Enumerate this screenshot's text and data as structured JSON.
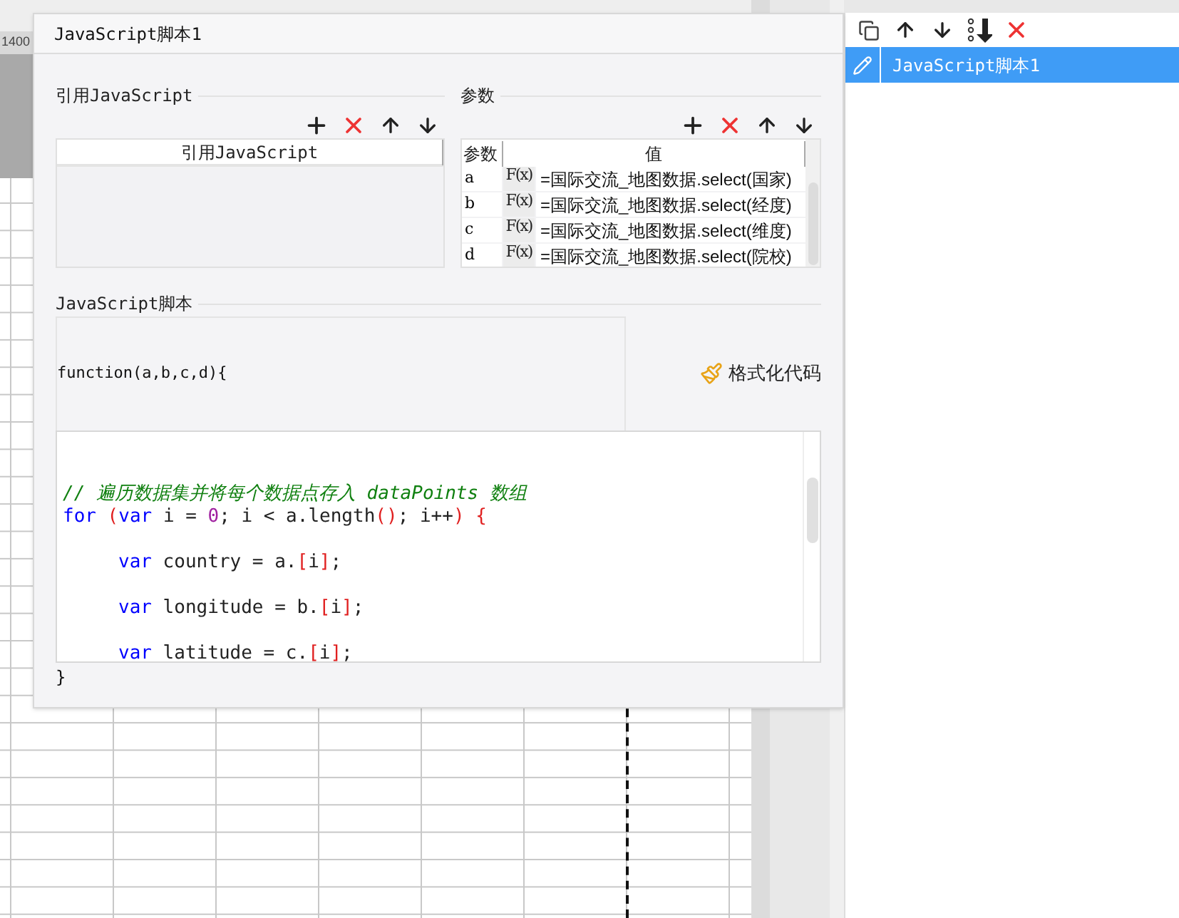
{
  "ruler": {
    "label": "1400"
  },
  "dialog": {
    "title": "JavaScript脚本1",
    "ref_section": {
      "title": "引用JavaScript",
      "column": "引用JavaScript"
    },
    "params_section": {
      "title": "参数",
      "columns": [
        "参数",
        "值"
      ],
      "rows": [
        {
          "name": "a",
          "formula_label": "F(x)",
          "value": "=国际交流_地图数据.select(国家)"
        },
        {
          "name": "b",
          "formula_label": "F(x)",
          "value": "=国际交流_地图数据.select(经度)"
        },
        {
          "name": "c",
          "formula_label": "F(x)",
          "value": "=国际交流_地图数据.select(维度)"
        },
        {
          "name": "d",
          "formula_label": "F(x)",
          "value": "=国际交流_地图数据.select(院校)"
        }
      ]
    },
    "script_section": {
      "title": "JavaScript脚本",
      "header": "function(a,b,c,d){",
      "format_button": "格式化代码",
      "footer": "}",
      "code_lines": [
        {
          "kind": "blank"
        },
        {
          "kind": "blank"
        },
        {
          "kind": "code",
          "segments": [
            {
              "text": "// 遍历数据集并将每个数据点存入 dataPoints 数组",
              "kind": "comment"
            }
          ]
        },
        {
          "kind": "code",
          "segments": [
            {
              "text": "for",
              "kind": "keyword"
            },
            {
              "text": " (",
              "kind": "bracket"
            },
            {
              "text": "var",
              "kind": "keyword"
            },
            {
              "text": " i = ",
              "kind": "plain"
            },
            {
              "text": "0",
              "kind": "number"
            },
            {
              "text": "; i < a.length",
              "kind": "plain"
            },
            {
              "text": "()",
              "kind": "bracket"
            },
            {
              "text": "; i++",
              "kind": "plain"
            },
            {
              "text": ") {",
              "kind": "bracket"
            }
          ]
        },
        {
          "kind": "blank"
        },
        {
          "kind": "indented",
          "segments": [
            {
              "text": "var",
              "kind": "keyword"
            },
            {
              "text": " country = a.",
              "kind": "plain"
            },
            {
              "text": "[",
              "kind": "bracket"
            },
            {
              "text": "i",
              "kind": "plain"
            },
            {
              "text": "]",
              "kind": "bracket"
            },
            {
              "text": ";",
              "kind": "plain"
            }
          ]
        },
        {
          "kind": "blank"
        },
        {
          "kind": "indented",
          "segments": [
            {
              "text": "var",
              "kind": "keyword"
            },
            {
              "text": " longitude = b.",
              "kind": "plain"
            },
            {
              "text": "[",
              "kind": "bracket"
            },
            {
              "text": "i",
              "kind": "plain"
            },
            {
              "text": "]",
              "kind": "bracket"
            },
            {
              "text": ";",
              "kind": "plain"
            }
          ]
        },
        {
          "kind": "blank"
        },
        {
          "kind": "indented",
          "segments": [
            {
              "text": "var",
              "kind": "keyword"
            },
            {
              "text": " latitude = c.",
              "kind": "plain"
            },
            {
              "text": "[",
              "kind": "bracket"
            },
            {
              "text": "i",
              "kind": "plain"
            },
            {
              "text": "]",
              "kind": "bracket"
            },
            {
              "text": ";",
              "kind": "plain"
            }
          ]
        }
      ]
    }
  },
  "side_panel": {
    "items": [
      {
        "label": "JavaScript脚本1",
        "selected": true
      }
    ]
  }
}
